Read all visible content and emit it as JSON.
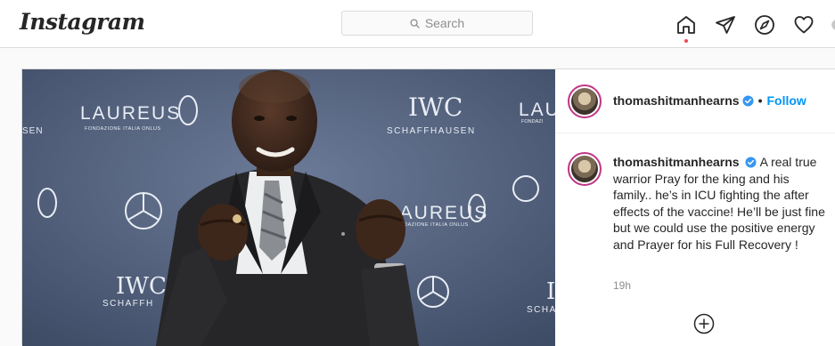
{
  "header": {
    "logo_text": "Instagram",
    "search_placeholder": "Search"
  },
  "nav": {
    "items": [
      {
        "name": "home-icon",
        "active": true
      },
      {
        "name": "direct-send-icon"
      },
      {
        "name": "explore-compass-icon"
      },
      {
        "name": "activity-heart-icon"
      }
    ],
    "active_indicator_color": "#ed4956"
  },
  "post": {
    "author": "thomashitmanhearns",
    "verified": true,
    "follow_label": "Follow",
    "separator": "•",
    "caption": "A real true warrior Pray for the king and his family.. he’s in ICU fighting the after effects of the vaccine! He’ll be just fine but we could use the positive energy and Prayer for his Full Recovery !",
    "time_ago": "19h",
    "photo_backdrop_text": {
      "brand_laureus": "LAUREUS",
      "laureus_sub": "FONDAZIONE ITALIA ONLUS",
      "brand_iwc": "IWC",
      "iwc_sub": "SCHAFFHAUSEN",
      "partial_sen": "SEN",
      "partial_schaff": "SCHAFFH",
      "partial_scha": "SCHA",
      "partial_fondazi": "FONDAZI",
      "partial_laur": "LAU",
      "partial_iwc_right": "I"
    }
  },
  "colors": {
    "accent_blue": "#0095f6",
    "verified_blue": "#3897f0",
    "border": "#dbdbdb",
    "muted_text": "#8e8e8e"
  }
}
